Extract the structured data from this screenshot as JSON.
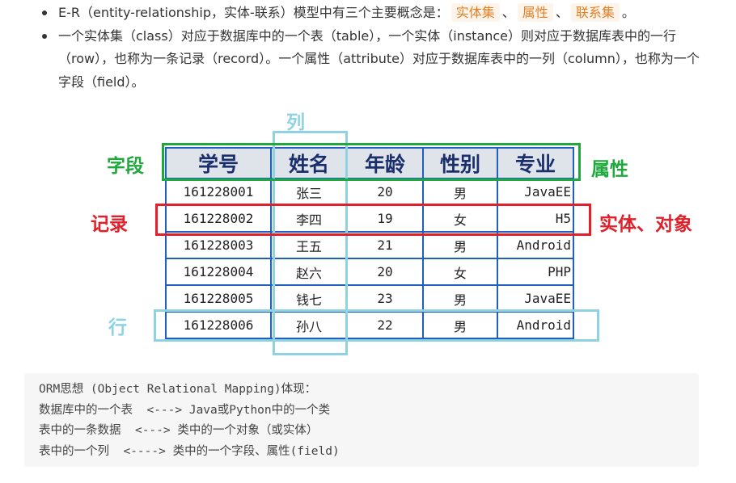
{
  "bullets": {
    "b1_prefix": "E-R（entity-relationship，实体-联系）模型中有三个主要概念是：",
    "b1_tags": [
      "实体集",
      "属性",
      "联系集"
    ],
    "b1_sep": "、",
    "b1_suffix": "。",
    "b2": "一个实体集（class）对应于数据库中的一个表（table），一个实体（instance）则对应于数据库表中的一行（row），也称为一条记录（record）。一个属性（attribute）对应于数据库表中的一列（column），也称为一个字段（field）。"
  },
  "figure": {
    "labels": {
      "column": "列",
      "field": "字段",
      "attribute": "属性",
      "record": "记录",
      "entity": "实体、对象",
      "row": "行"
    },
    "table": {
      "headers": [
        "学号",
        "姓名",
        "年龄",
        "性别",
        "专业"
      ],
      "rows": [
        [
          "161228001",
          "张三",
          "20",
          "男",
          "JavaEE"
        ],
        [
          "161228002",
          "李四",
          "19",
          "女",
          "H5"
        ],
        [
          "161228003",
          "王五",
          "21",
          "男",
          "Android"
        ],
        [
          "161228004",
          "赵六",
          "20",
          "女",
          "PHP"
        ],
        [
          "161228005",
          "钱七",
          "23",
          "男",
          "JavaEE"
        ],
        [
          "161228006",
          "孙八",
          "22",
          "男",
          "Android"
        ]
      ]
    },
    "colors": {
      "column": "#8fd3e3",
      "field": "#1fa83b",
      "record": "#e0212b",
      "table_border": "#1f5fbf"
    }
  },
  "code": {
    "lines": [
      "ORM思想 (Object Relational Mapping)体现：",
      "数据库中的一个表  <---> Java或Python中的一个类",
      "表中的一条数据  <---> 类中的一个对象（或实体）",
      "表中的一个列  <----> 类中的一个字段、属性(field)"
    ]
  }
}
